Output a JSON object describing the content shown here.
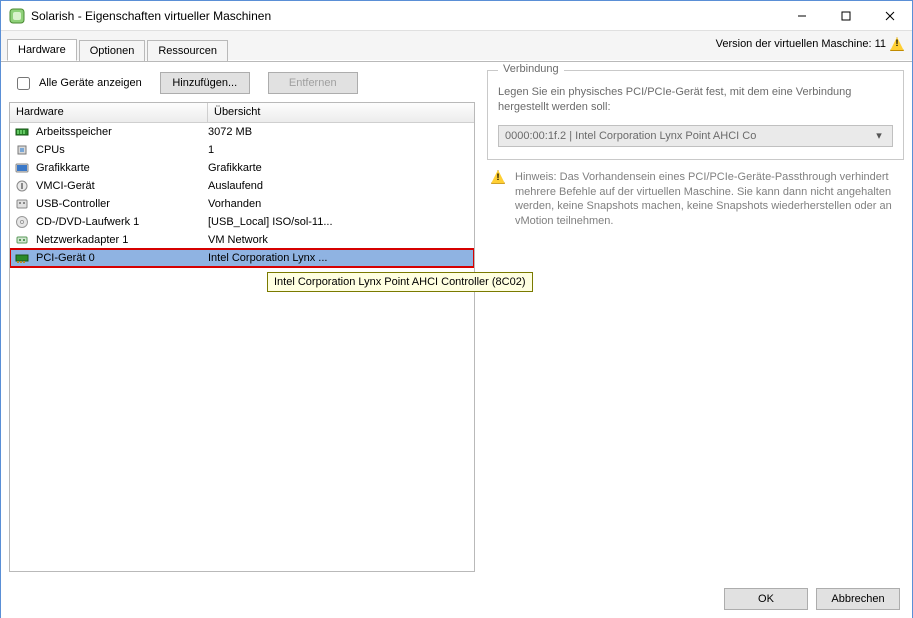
{
  "window": {
    "title": "Solarish - Eigenschaften virtueller Maschinen"
  },
  "tabs": [
    {
      "label": "Hardware",
      "active": true
    },
    {
      "label": "Optionen",
      "active": false
    },
    {
      "label": "Ressourcen",
      "active": false
    }
  ],
  "version_label": "Version der virtuellen Maschine: 11",
  "controls": {
    "show_all_label": "Alle Geräte anzeigen",
    "add_button": "Hinzufügen...",
    "remove_button": "Entfernen"
  },
  "table": {
    "col_hardware": "Hardware",
    "col_overview": "Übersicht",
    "rows": [
      {
        "icon": "memory-icon",
        "name": "Arbeitsspeicher",
        "overview": "3072 MB"
      },
      {
        "icon": "cpu-icon",
        "name": "CPUs",
        "overview": "1"
      },
      {
        "icon": "video-icon",
        "name": "Grafikkarte",
        "overview": "Grafikkarte"
      },
      {
        "icon": "vmci-icon",
        "name": "VMCI-Gerät",
        "overview": "Auslaufend"
      },
      {
        "icon": "usb-icon",
        "name": "USB-Controller",
        "overview": "Vorhanden"
      },
      {
        "icon": "cd-icon",
        "name": "CD-/DVD-Laufwerk 1",
        "overview": "[USB_Local] ISO/sol-11..."
      },
      {
        "icon": "nic-icon",
        "name": "Netzwerkadapter 1",
        "overview": "VM Network"
      },
      {
        "icon": "pci-icon",
        "name": "PCI-Gerät 0",
        "overview": "Intel Corporation Lynx ...",
        "selected": true
      }
    ]
  },
  "tooltip": "Intel Corporation Lynx Point AHCI Controller (8C02)",
  "right": {
    "group_title": "Verbindung",
    "group_text": "Legen Sie ein physisches PCI/PCIe-Gerät fest, mit dem eine Verbindung hergestellt werden soll:",
    "select_value": "0000:00:1f.2 |  Intel Corporation Lynx Point AHCI Co",
    "hint": "Hinweis: Das Vorhandensein eines PCI/PCIe-Geräte-Passthrough verhindert mehrere Befehle auf der virtuellen Maschine. Sie kann dann nicht angehalten werden, keine Snapshots machen, keine Snapshots wiederherstellen oder an vMotion teilnehmen."
  },
  "footer": {
    "ok": "OK",
    "cancel": "Abbrechen"
  }
}
